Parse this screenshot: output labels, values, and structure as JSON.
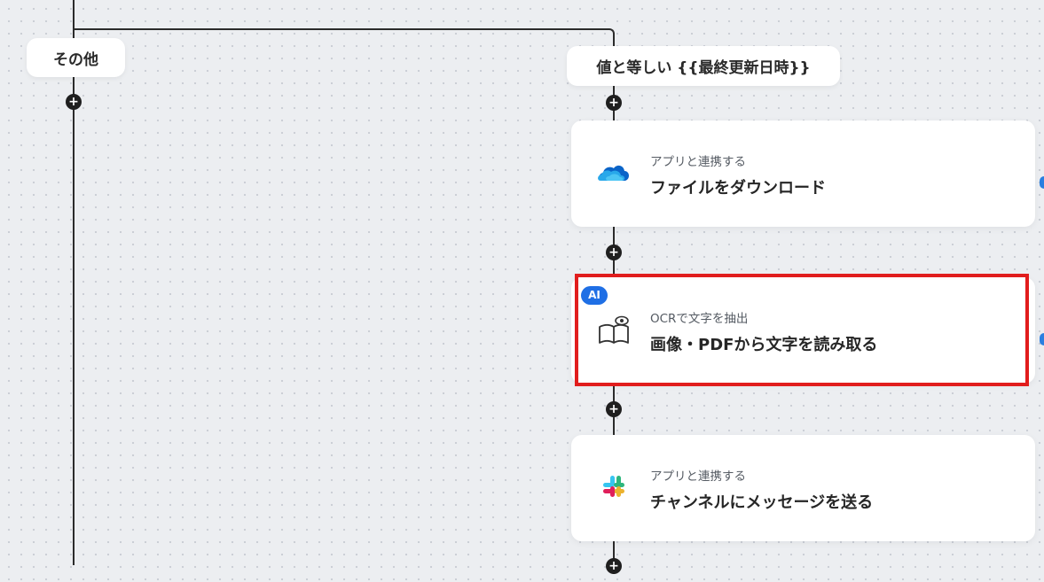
{
  "branches": {
    "other_label": "その他",
    "condition_label": "値と等しい {{最終更新日時}}"
  },
  "steps": [
    {
      "subtitle": "アプリと連携する",
      "title": "ファイルをダウンロード",
      "icon": "onedrive-icon"
    },
    {
      "subtitle": "OCRで文字を抽出",
      "title": "画像・PDFから文字を読み取る",
      "icon": "ocr-book-eye-icon",
      "badge": "AI",
      "highlighted": true
    },
    {
      "subtitle": "アプリと連携する",
      "title": "チャンネルにメッセージを送る",
      "icon": "slack-icon"
    }
  ],
  "add_step_symbol": "+",
  "colors": {
    "highlight": "#e11d1d",
    "ai_badge": "#1f6fe5",
    "connector": "#2b2b2b"
  }
}
